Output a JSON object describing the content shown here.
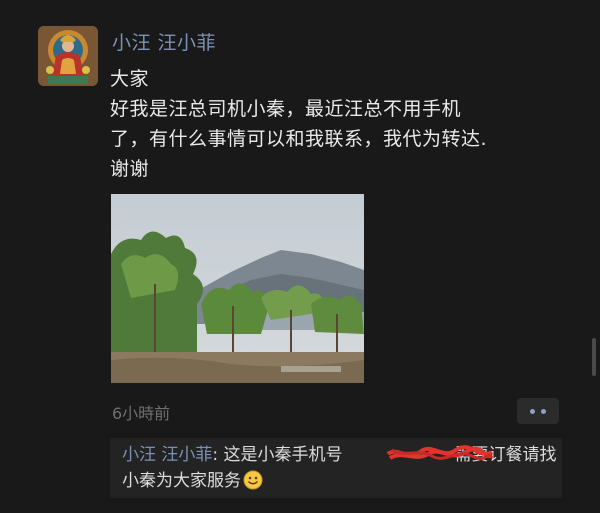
{
  "post": {
    "author": "小汪 汪小菲",
    "lines": [
      "大家",
      "好我是汪总司机小秦，最近汪总不用手机",
      "了，有什么事情可以和我联系，我代为转达.",
      "谢谢"
    ],
    "time": "6小時前",
    "photo_icon": "landscape-photo",
    "avatar_icon": "buddhist-painting-avatar"
  },
  "comment": {
    "author": "小汪 汪小菲",
    "separator": ": ",
    "text_before": "这是小秦手机号",
    "text_after": "需要订餐请找小秦为大家服务",
    "emoji_icon": "smiley-face",
    "redaction_color": "#e0342f"
  },
  "colors": {
    "background": "#191919",
    "name": "#7d90b5",
    "text": "#e9e9e9",
    "muted": "#6f6f6f"
  },
  "icons": {
    "more": "more-dots-icon"
  }
}
